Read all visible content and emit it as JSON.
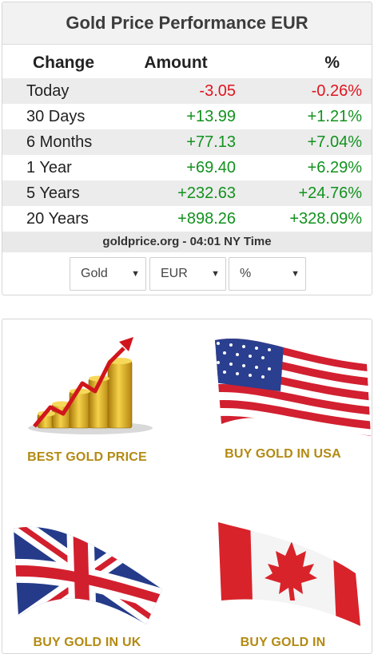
{
  "widget": {
    "title": "Gold Price Performance EUR",
    "headers": [
      "Change",
      "Amount",
      "%"
    ],
    "rows": [
      {
        "period": "Today",
        "amount": "-3.05",
        "percent": "-0.26%",
        "trend": "neg"
      },
      {
        "period": "30 Days",
        "amount": "+13.99",
        "percent": "+1.21%",
        "trend": "pos"
      },
      {
        "period": "6 Months",
        "amount": "+77.13",
        "percent": "+7.04%",
        "trend": "pos"
      },
      {
        "period": "1 Year",
        "amount": "+69.40",
        "percent": "+6.29%",
        "trend": "pos"
      },
      {
        "period": "5 Years",
        "amount": "+232.63",
        "percent": "+24.76%",
        "trend": "pos"
      },
      {
        "period": "20 Years",
        "amount": "+898.26",
        "percent": "+328.09%",
        "trend": "pos"
      }
    ],
    "source": "goldprice.org - 04:01 NY Time",
    "selects": {
      "metal": "Gold",
      "currency": "EUR",
      "unit": "%"
    }
  },
  "cards": {
    "best_gold_price": "BEST GOLD PRICE",
    "buy_usa": "BUY GOLD IN USA",
    "buy_uk": "BUY GOLD IN UK",
    "buy_canada": "BUY GOLD IN"
  },
  "colors": {
    "negative": "#e0141e",
    "positive": "#12921e",
    "card_label": "#b38a12"
  },
  "icons": [
    "gold-coins-chart-icon",
    "usa-flag-icon",
    "uk-flag-icon",
    "canada-flag-icon",
    "dropdown-arrow-icon"
  ]
}
